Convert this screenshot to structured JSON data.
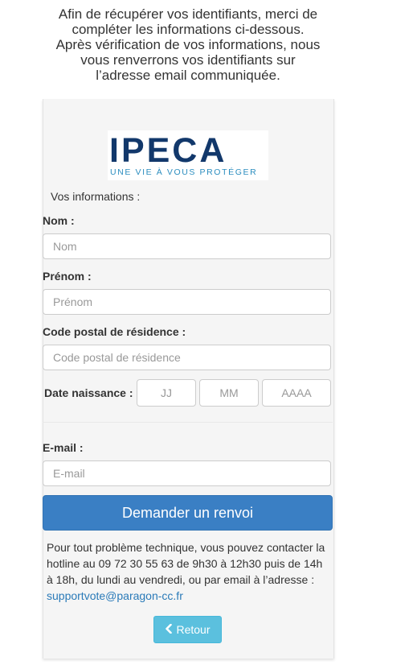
{
  "intro": {
    "line1": "Afin de récupérer vos identifiants, merci de",
    "line2": "compléter les informations ci-dessous.",
    "line3": "Après vérification de vos informations, nous",
    "line4": "vous renverrons vos identifiants sur",
    "line5": "l’adresse email communiquée."
  },
  "logo": {
    "brand": "IPECA",
    "tagline": "UNE VIE À VOUS PROTÉGER",
    "brand_color": "#12386b",
    "tagline_color": "#2b8dbf"
  },
  "form": {
    "section_title": "Vos informations :",
    "nom_label": "Nom :",
    "nom_placeholder": "Nom",
    "prenom_label": "Prénom :",
    "prenom_placeholder": "Prénom",
    "cp_label": "Code postal de résidence :",
    "cp_placeholder": "Code postal de résidence",
    "date_label": "Date naissance :",
    "day_placeholder": "JJ",
    "month_placeholder": "MM",
    "year_placeholder": "AAAA",
    "email_label": "E-mail :",
    "email_placeholder": "E-mail",
    "submit_label": "Demander un renvoi"
  },
  "support": {
    "text": "Pour tout problème technique, vous pouvez contacter la hotline au 09 72 30 55 63 de 9h30 à 12h30 puis de 14h à 18h, du lundi au vendredi, ou par email à l’adresse : ",
    "email": "supportvote@paragon-cc.fr"
  },
  "back_button": {
    "label": "Retour",
    "icon": "chevron-left-icon"
  },
  "colors": {
    "primary_button": "#3a7fc4",
    "info_button": "#5bc0de",
    "link": "#2a7ab8",
    "panel_bg": "#f5f5f5"
  }
}
